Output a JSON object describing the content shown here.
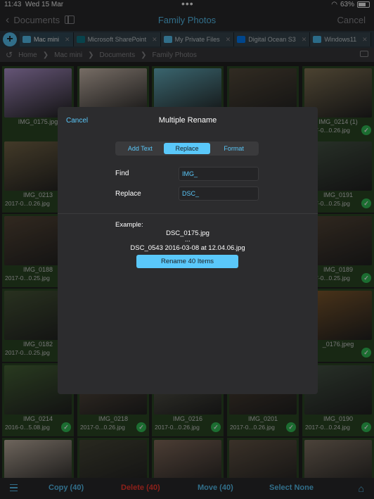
{
  "status": {
    "time": "11:43",
    "date": "Wed 15 Mar",
    "battery": "63%"
  },
  "nav": {
    "back": "Documents",
    "title": "Family Photos",
    "cancel": "Cancel"
  },
  "tabs": [
    {
      "label": "Mac mini",
      "icon": "monitor-icon",
      "color": "#5ac8fa"
    },
    {
      "label": "Microsoft SharePoint",
      "icon": "sharepoint-icon",
      "color": "#0f7b8a"
    },
    {
      "label": "My Private Files",
      "icon": "folder-icon",
      "color": "#5ac8fa"
    },
    {
      "label": "Digital Ocean S3",
      "icon": "digitalocean-icon",
      "color": "#0080ff"
    },
    {
      "label": "Windows11",
      "icon": "windows-icon",
      "color": "#4fc3f7"
    }
  ],
  "breadcrumb": [
    "Home",
    "Mac mini",
    "Documents",
    "Family Photos"
  ],
  "grid": [
    {
      "name": "IMG_0175.jpg",
      "date": "",
      "checked": false,
      "color": "#b89bd8"
    },
    {
      "name": "",
      "date": "",
      "checked": false,
      "color": "#d8c6b8"
    },
    {
      "name": "",
      "date": "",
      "checked": false,
      "color": "#6ab8c9"
    },
    {
      "name": "",
      "date": "",
      "checked": false,
      "color": "#5a4f3f"
    },
    {
      "name": "IMG_0214 (1)",
      "date": "2017-0...0.26.jpg",
      "checked": true,
      "color": "#8a7a5a"
    },
    {
      "name": "IMG_0213",
      "date": "2017-0...0.26.jpg",
      "checked": false,
      "color": "#7a6a4a"
    },
    {
      "name": "",
      "date": "",
      "checked": false,
      "color": "#4a5a3a"
    },
    {
      "name": "",
      "date": "",
      "checked": false,
      "color": "#5a6a3a"
    },
    {
      "name": "",
      "date": "",
      "checked": false,
      "color": "#4a5040"
    },
    {
      "name": "IMG_0191",
      "date": "2017-0...0.25.jpg",
      "checked": true,
      "color": "#4a5a4a"
    },
    {
      "name": "IMG_0188",
      "date": "2017-0...0.25.jpg",
      "checked": false,
      "color": "#5a4a3a"
    },
    {
      "name": "",
      "date": "",
      "checked": false,
      "color": "#4a4030"
    },
    {
      "name": "",
      "date": "",
      "checked": false,
      "color": "#504030"
    },
    {
      "name": "",
      "date": "",
      "checked": false,
      "color": "#4a3a30"
    },
    {
      "name": "IMG_0189",
      "date": "2017-0...0.25.jpg",
      "checked": true,
      "color": "#5a4a3a"
    },
    {
      "name": "IMG_0182",
      "date": "2017-0...0.25.jpg",
      "checked": false,
      "color": "#4a5a3a"
    },
    {
      "name": "",
      "date": "",
      "checked": false,
      "color": "#3a4a3a"
    },
    {
      "name": "",
      "date": "",
      "checked": false,
      "color": "#3a3a30"
    },
    {
      "name": "",
      "date": "",
      "checked": false,
      "color": "#2a2a30"
    },
    {
      "name": "_0176.jpeg",
      "date": "",
      "checked": true,
      "color": "#8a6030"
    },
    {
      "name": "IMG_0214",
      "date": "2016-0...5.08.jpg",
      "checked": true,
      "color": "#4a6a3a"
    },
    {
      "name": "IMG_0218",
      "date": "2017-0...0.26.jpg",
      "checked": true,
      "color": "#6a5a4a"
    },
    {
      "name": "IMG_0216",
      "date": "2017-0...0.26.jpg",
      "checked": true,
      "color": "#6a6a5a"
    },
    {
      "name": "IMG_0201",
      "date": "2017-0...0.26.jpg",
      "checked": true,
      "color": "#5a4a3a"
    },
    {
      "name": "IMG_0190",
      "date": "2017-0...0.24.jpg",
      "checked": true,
      "color": "#4a5a4a"
    },
    {
      "name": "",
      "date": "",
      "checked": false,
      "color": "#c8b8a8"
    },
    {
      "name": "",
      "date": "",
      "checked": false,
      "color": "#4a4a3a"
    },
    {
      "name": "",
      "date": "",
      "checked": false,
      "color": "#8a7060"
    },
    {
      "name": "",
      "date": "",
      "checked": false,
      "color": "#6a5a4a"
    },
    {
      "name": "",
      "date": "",
      "checked": false,
      "color": "#8a7a6a"
    }
  ],
  "modal": {
    "cancel": "Cancel",
    "title": "Multiple Rename",
    "segments": [
      "Add Text",
      "Replace",
      "Format"
    ],
    "selected_segment": "Replace",
    "find_label": "Find",
    "find_value": "IMG_",
    "replace_label": "Replace",
    "replace_value": "DSC_",
    "example_label": "Example:",
    "example_first": "DSC_0175.jpg",
    "example_ellipsis": "...",
    "example_last": "DSC_0543 2016-03-08 at 12.04.06.jpg",
    "rename_button": "Rename 40 Items"
  },
  "toolbar": {
    "copy": "Copy (40)",
    "delete": "Delete (40)",
    "move": "Move (40)",
    "select_none": "Select None"
  },
  "colors": {
    "accent": "#5ac8fa",
    "delete": "#ff3b30",
    "check": "#34c759"
  }
}
